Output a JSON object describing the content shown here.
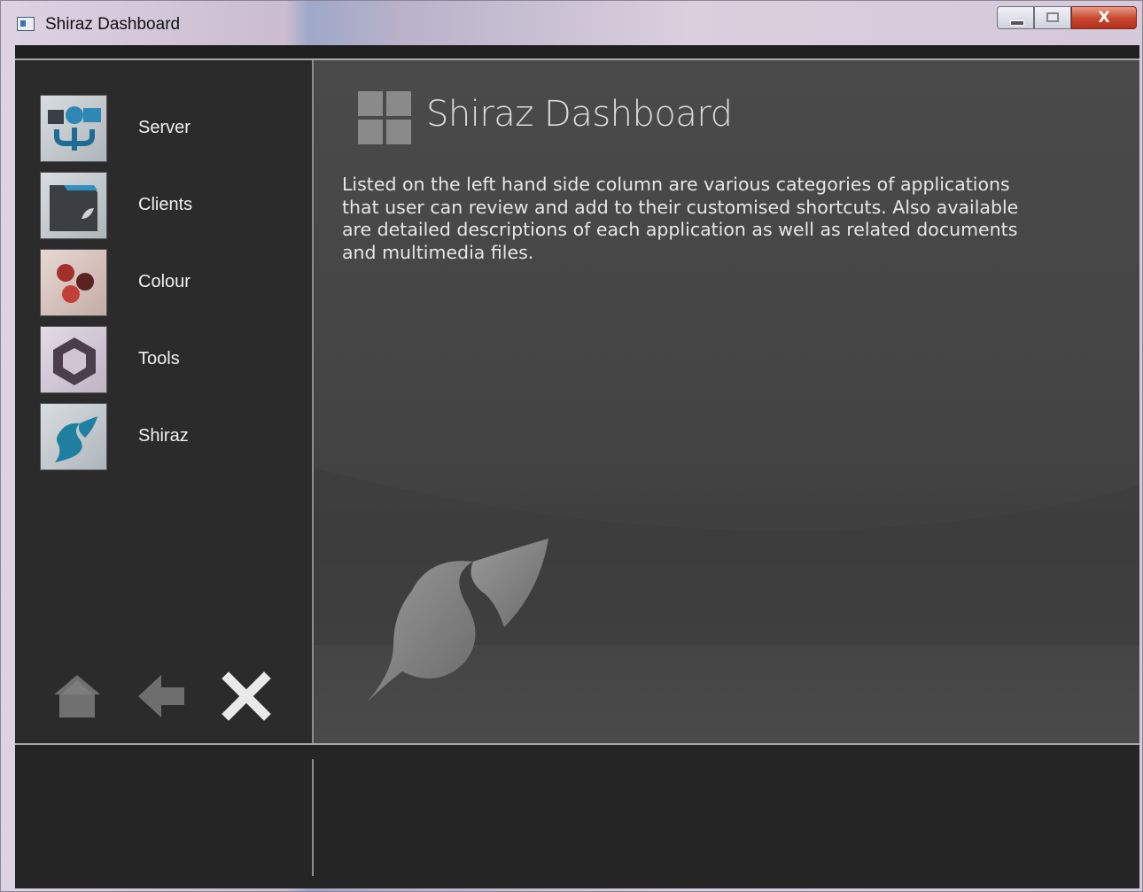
{
  "window": {
    "title": "Shiraz Dashboard",
    "close_glyph": "X"
  },
  "sidebar": {
    "items": [
      {
        "label": "Server",
        "icon": "server-icon"
      },
      {
        "label": "Clients",
        "icon": "clients-icon"
      },
      {
        "label": "Colour",
        "icon": "colour-icon"
      },
      {
        "label": "Tools",
        "icon": "tools-icon"
      },
      {
        "label": "Shiraz",
        "icon": "shiraz-icon"
      }
    ],
    "bottom_actions": [
      "home-icon",
      "back-arrow-icon",
      "close-icon"
    ]
  },
  "main": {
    "title": "Shiraz Dashboard",
    "description": "Listed on the left hand side column are various categories of applications that user can review and add to their customised shortcuts. Also available are detailed descriptions of each application as well as related documents and multimedia files."
  },
  "colors": {
    "sidebar_bg": "#2b2b2b",
    "main_bg": "#4a4a4a",
    "text": "#e6e6e6",
    "accent_teal": "#1f7fa0"
  }
}
